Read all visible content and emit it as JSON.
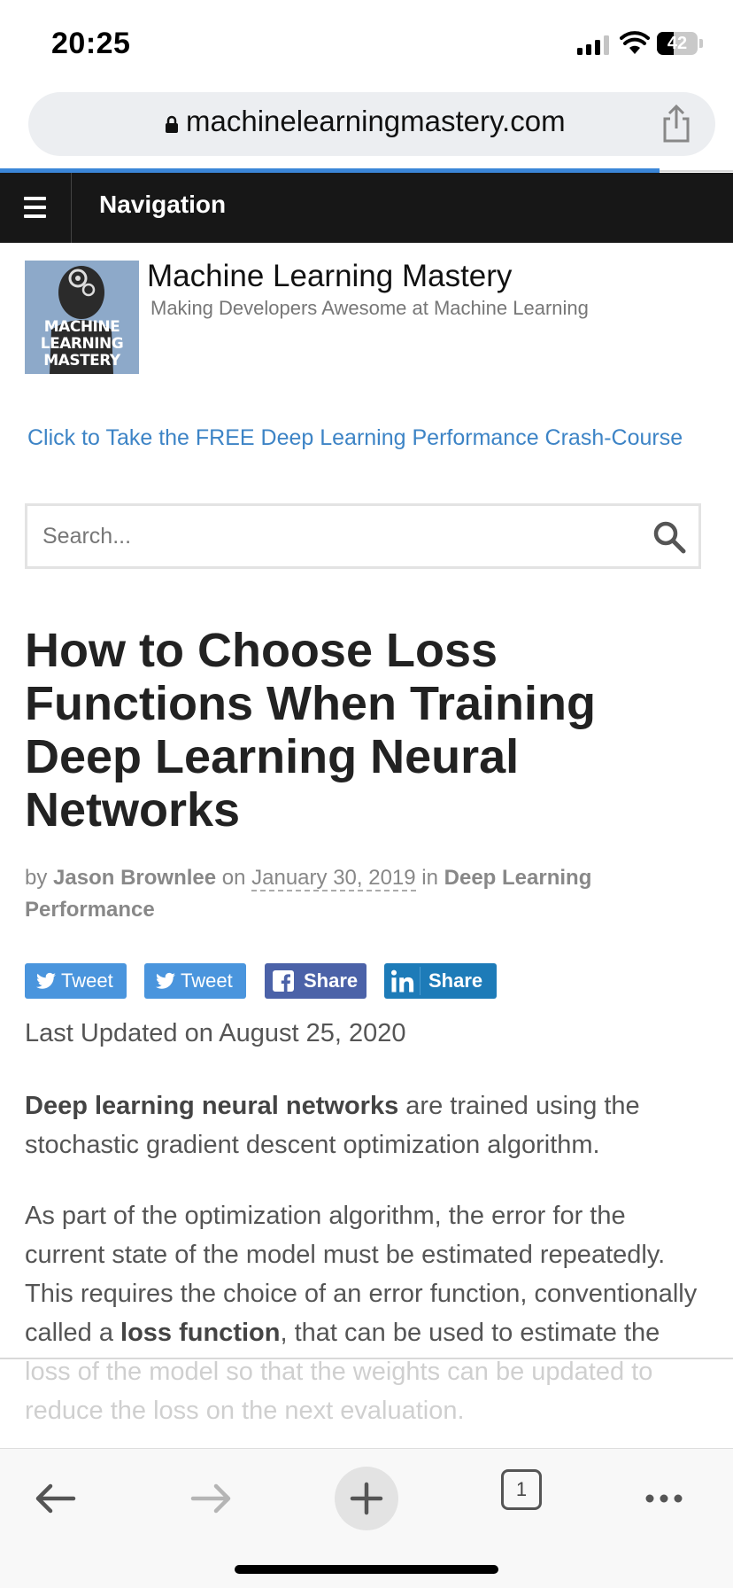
{
  "status_bar": {
    "time": "20:25",
    "battery": "42",
    "battery_level": 0.42,
    "icons": [
      "signal-icon",
      "wifi-icon",
      "battery-icon"
    ]
  },
  "browser": {
    "url": "machinelearningmastery.com",
    "accent_color": "#3b86d8",
    "icons": [
      "lock-icon",
      "share-icon"
    ]
  },
  "nav": {
    "label": "Navigation",
    "icon": "hamburger-icon"
  },
  "site": {
    "logo_line1": "MACHINE",
    "logo_line2": "LEARNING",
    "logo_line3": "MASTERY",
    "title": "Machine Learning Mastery",
    "tagline": "Making Developers Awesome at Machine Learning",
    "crash_course_link": "Click to Take the FREE Deep Learning Performance Crash-Course",
    "link_color": "#3d84c6"
  },
  "search": {
    "placeholder": "Search...",
    "icon": "search-icon"
  },
  "article": {
    "title": "How to Choose Loss Functions When Training Deep Learning Neural Networks",
    "meta": {
      "by": "by",
      "author": "Jason Brownlee",
      "on": "on",
      "date": "January 30, 2019",
      "in": "in",
      "category": "Deep Learning Performance"
    },
    "share_buttons": [
      {
        "label": "Tweet",
        "icon": "twitter-icon",
        "color": "#4a95dd"
      },
      {
        "label": "Tweet",
        "icon": "twitter-icon",
        "color": "#4a95dd"
      },
      {
        "label": "Share",
        "icon": "facebook-icon",
        "color": "#4b62a8"
      },
      {
        "label": "Share",
        "icon": "linkedin-icon",
        "color": "#1d7bb8"
      }
    ],
    "last_updated": "Last Updated on August 25, 2020",
    "p1": {
      "bold": "Deep learning neural networks",
      "rest": " are trained using the stochastic gradient descent optimization algorithm."
    },
    "p2": {
      "before": "As part of the optimization algorithm, the error for the current state of the model must be estimated repeatedly. This requires the choice of an error function, conventionally called a ",
      "bold": "loss function",
      "after": ", that can be used to estimate the loss of the model so that the weights can be updated to reduce the loss on the next evaluation."
    }
  },
  "toolbar": {
    "tab_count": "1",
    "icons": [
      "back-arrow-icon",
      "forward-arrow-icon",
      "new-tab-icon",
      "tabs-icon",
      "more-icon"
    ]
  }
}
